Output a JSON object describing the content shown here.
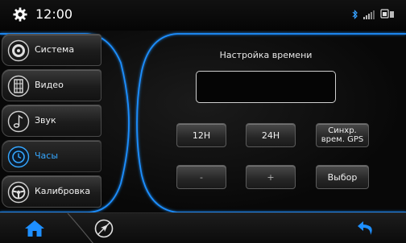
{
  "status": {
    "time": "12:00"
  },
  "menu": [
    {
      "label": "Система"
    },
    {
      "label": "Видео"
    },
    {
      "label": "Звук"
    },
    {
      "label": "Часы"
    },
    {
      "label": "Калибровка"
    }
  ],
  "content": {
    "title": "Настройка времени",
    "display_value": ""
  },
  "buttons": {
    "h12": "12H",
    "h24": "24H",
    "gps_line1": "Синхр.",
    "gps_line2": "врем. GPS",
    "minus": "-",
    "plus": "+",
    "select": "Выбор"
  },
  "colors": {
    "accent": "#1e8fff",
    "active_text": "#35a7ff"
  }
}
